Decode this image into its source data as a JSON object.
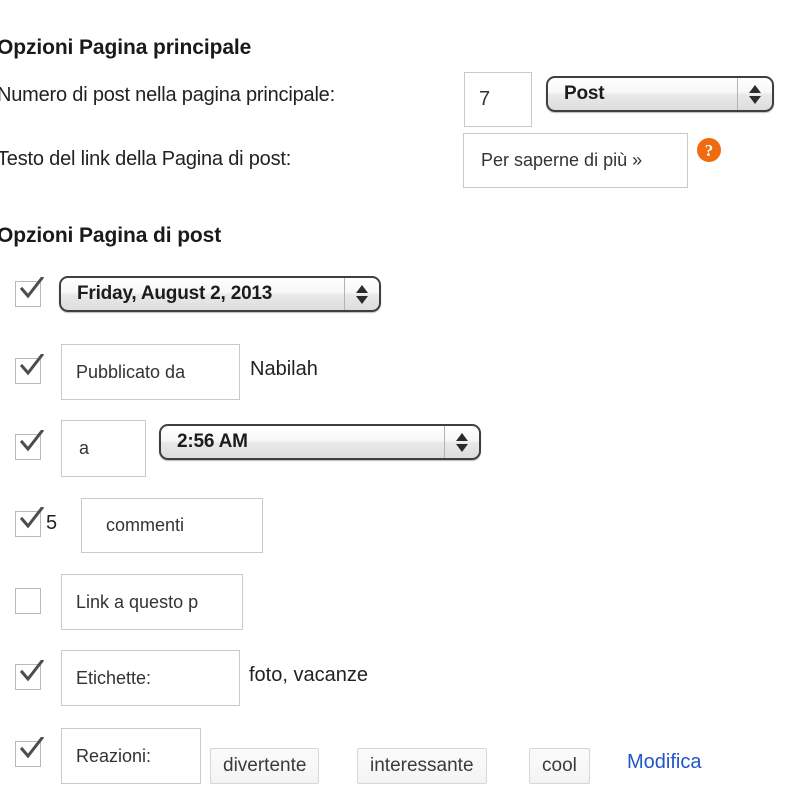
{
  "home_section": {
    "heading": "Opzioni Pagina principale",
    "num_posts_label": "Numero di post nella pagina principale:",
    "num_posts_value": "7",
    "post_type_value": "Post",
    "link_text_label": "Testo del link della Pagina di post:",
    "link_text_value": "Per saperne di più »",
    "help_icon_glyph": "?"
  },
  "post_section": {
    "heading": "Opzioni Pagina di post",
    "rows": {
      "date": {
        "checked": true,
        "value": "Friday, August 2, 2013"
      },
      "author": {
        "checked": true,
        "input_value": "Pubblicato da",
        "name": "Nabilah"
      },
      "time": {
        "checked": true,
        "input_value": "a",
        "time_value": "2:56 AM"
      },
      "comments": {
        "checked": true,
        "count": "5",
        "input_value": "commenti"
      },
      "permalink": {
        "checked": false,
        "input_value": "Link a questo p"
      },
      "tags": {
        "checked": true,
        "input_value": "Etichette:",
        "tags_text": "foto, vacanze"
      },
      "reactions": {
        "checked": true,
        "input_value": "Reazioni:",
        "buttons": [
          "divertente",
          "interessante",
          "cool"
        ],
        "edit_label": "Modifica"
      }
    }
  },
  "colors": {
    "accent_orange": "#f06a10",
    "link_blue": "#2255cc",
    "text": "#222222",
    "border": "#c9c9c9"
  }
}
